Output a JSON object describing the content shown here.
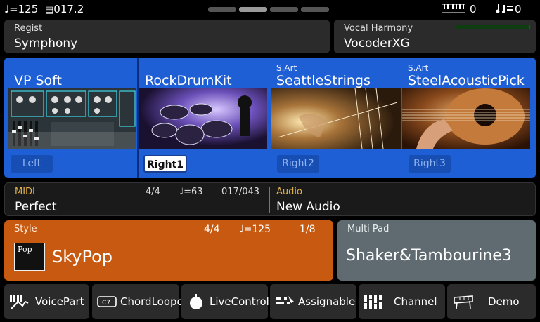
{
  "status": {
    "tempo": "♩=125",
    "measure": "017.2",
    "keyboard_count": "0",
    "sequence_count": "0"
  },
  "regist": {
    "label": "Regist",
    "value": "Symphony"
  },
  "vocal_harmony": {
    "label": "Vocal Harmony",
    "value": "VocoderXG"
  },
  "voices": [
    {
      "art": "",
      "name": "VP Soft",
      "part": "Left"
    },
    {
      "art": "",
      "name": "RockDrumKit",
      "part": "Right1"
    },
    {
      "art": "S.Art",
      "name": "SeattleStrings",
      "part": "Right2"
    },
    {
      "art": "S.Art",
      "name": "SteelAcousticPick",
      "part": "Right3"
    }
  ],
  "midi": {
    "label": "MIDI",
    "value": "Perfect",
    "time_sig": "4/4",
    "tempo": "♩=63",
    "position": "017/043"
  },
  "audio": {
    "label": "Audio",
    "value": "New Audio"
  },
  "style": {
    "label": "Style",
    "time_sig": "4/4",
    "tempo": "♩=125",
    "beat": "1/8",
    "name": "SkyPop",
    "badge": "Pop"
  },
  "multipad": {
    "label": "Multi Pad",
    "value": "Shaker&Tambourine3"
  },
  "buttons": [
    {
      "label": "VoicePart"
    },
    {
      "label": "ChordLooper"
    },
    {
      "label": "LiveControl"
    },
    {
      "label": "Assignable"
    },
    {
      "label": "Channel"
    },
    {
      "label": "Demo"
    }
  ],
  "colors": {
    "voice_bg": "#1f5fd6",
    "style_bg": "#c75a10",
    "pad_bg": "#5f6b70",
    "label_gold": "#e0b04a"
  }
}
